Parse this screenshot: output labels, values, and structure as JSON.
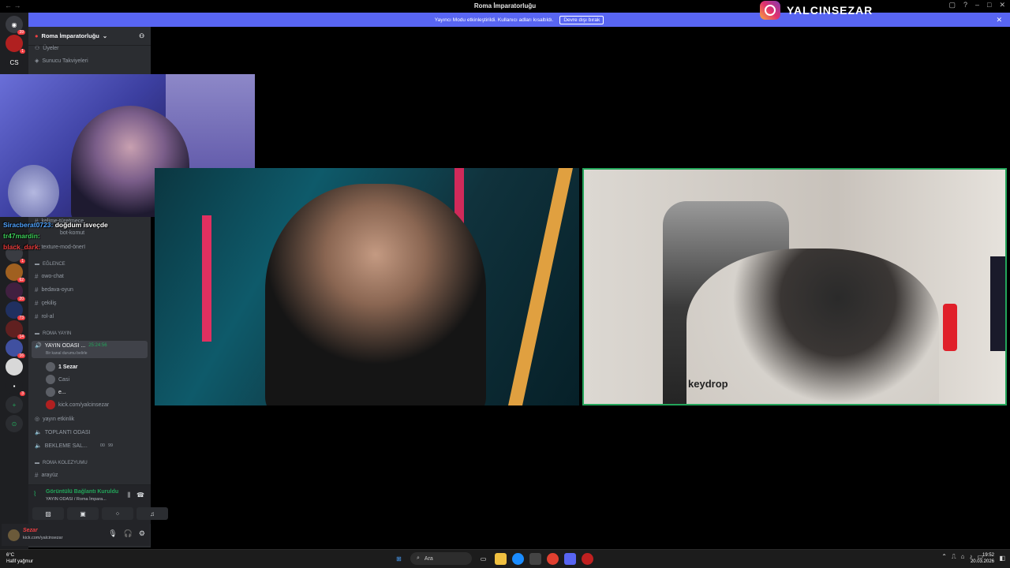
{
  "window": {
    "title": "Roma İmparatorluğu"
  },
  "overlay": {
    "instagram_handle": "YALCINSEZAR"
  },
  "banner": {
    "text": "Yayıncı Modu etkinleştirildi. Kullanıcı adları kısaltıldı.",
    "button": "Devre dışı bırak"
  },
  "guilds": [
    {
      "label": "",
      "badge": "39"
    },
    {
      "label": "",
      "badge": "1"
    },
    {
      "label": "CS",
      "badge": ""
    },
    {
      "label": "",
      "badge": "1"
    },
    {
      "label": "",
      "badge": "62"
    },
    {
      "label": "",
      "badge": "20"
    },
    {
      "label": "",
      "badge": "73"
    },
    {
      "label": "",
      "badge": "14"
    },
    {
      "label": "",
      "badge": "16"
    },
    {
      "label": "",
      "badge": ""
    },
    {
      "label": "",
      "badge": "3"
    }
  ],
  "server": {
    "name": "Roma İmparatorluğu"
  },
  "channels": {
    "members": "Üyeler",
    "boosts": "Sunucu Takviyeleri",
    "kelime": "kelime-türetmece",
    "bot": "bot-komut",
    "texture": "texture-mod-önerI",
    "cat_eglence": "EĞLENCE",
    "owo": "owo-chat",
    "bedava": "bedava-oyun",
    "cekilis": "çekiliş",
    "rol": "rol-al",
    "cat_roma_yayin": "ROMA YAYIN",
    "yayin_odasi": "YAYIN ODASI ...",
    "yayin_time": "25:24:56",
    "channel_status": "Bir kanal durumu belirle",
    "users": [
      "1 Sezar",
      "Casi",
      "e...",
      "kick.com/yalcinsezar"
    ],
    "yayin_etkinlik": "yayın etkinlik",
    "toplanti": "TOPLANTI ODASI",
    "bekleme": "BEKLEME SAL...",
    "bekleme_count1": "00",
    "bekleme_count2": "99",
    "cat_kolezyum": "ROMA KOLEZYUMU",
    "arayuz": "arayüz"
  },
  "voice_panel": {
    "status": "Görüntülü Bağlantı Kuruldu",
    "location": "YAYIN ODASI  / Roma İmpara..."
  },
  "user_panel": {
    "name": "Sezar",
    "status": "kick.com/yalcinsezar"
  },
  "chat": [
    {
      "user": "Siracberat0723:",
      "message": "doğdum isveçde",
      "color": "#4fa3ff"
    },
    {
      "user": "tr47mardin:",
      "message": "",
      "color": "#3ed15a"
    },
    {
      "user": "black_dark:",
      "message": "",
      "color": "#e83a3a"
    }
  ],
  "video": {
    "right_brand": "keydrop"
  },
  "taskbar": {
    "weather_temp": "6°C",
    "weather_desc": "Hafif yağmur",
    "search": "Ara",
    "time": "19:52",
    "date": "20.03.2026"
  }
}
